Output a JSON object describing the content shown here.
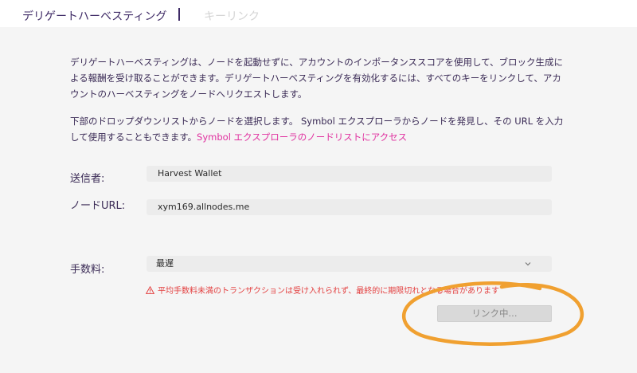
{
  "tabs": {
    "active_label": "デリゲートハーベスティング",
    "inactive_label": "キーリンク"
  },
  "description": {
    "paragraph1": "デリゲートハーベスティングは、ノードを起動せずに、アカウントのインポータンススコアを使用して、ブロック生成による報酬を受け取ることができます。デリゲートハーベスティングを有効化するには、すべてのキーをリンクして、アカウントのハーベスティングをノードへリクエストします。",
    "paragraph2_text": "下部のドロップダウンリストからノードを選択します。 Symbol エクスプローラからノードを発見し、その URL を入力して使用することもできます。",
    "paragraph2_link": "Symbol エクスプローラのノードリストにアクセス"
  },
  "form": {
    "sender_label": "送信者:",
    "sender_value": "Harvest Wallet",
    "node_label": "ノードURL:",
    "node_value": "xym169.allnodes.me",
    "fee_label": "手数料:",
    "fee_selected": "最遅",
    "fee_warning": "平均手数料未満のトランザクションは受け入れられず、最終的に期限切れとなる場合があります",
    "submit_label": "リンク中..."
  },
  "colors": {
    "accent_pink": "#e0309f",
    "warning_red": "#e34040",
    "annotation_orange": "#f0a030"
  },
  "icons": {
    "warning": "warning-triangle-icon",
    "chevron": "chevron-down-icon"
  }
}
